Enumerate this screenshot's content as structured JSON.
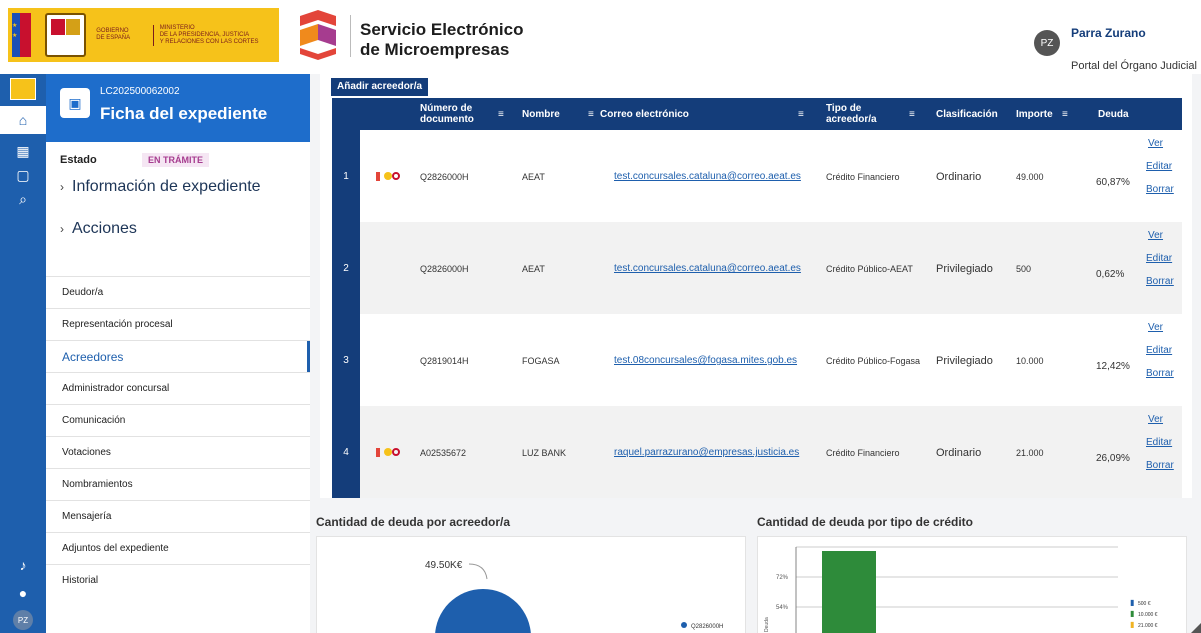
{
  "header": {
    "gob_line1": "GOBIERNO",
    "gob_line2": "DE ESPAÑA",
    "ministry_line1": "MINISTERIO",
    "ministry_line2": "DE LA PRESIDENCIA, JUSTICIA",
    "ministry_line3": "Y RELACIONES CON LAS CORTES",
    "service_line1": "Servicio Electrónico",
    "service_line2": "de Microempresas",
    "user_initials": "PZ",
    "user_name": "Parra Zurano",
    "portal": "Portal del Órgano Judicial"
  },
  "rail": {
    "bottom_initials": "PZ"
  },
  "side": {
    "case_code": "LC202500062002",
    "title": "Ficha del expediente",
    "estado_label": "Estado",
    "estado_value": "EN TRÁMITE",
    "accordion": [
      "Información de expediente",
      "Acciones"
    ],
    "menu": [
      "Deudor/a",
      "Representación procesal",
      "Acreedores",
      "Administrador concursal",
      "Comunicación",
      "Votaciones",
      "Nombramientos",
      "Mensajería",
      "Adjuntos del expediente",
      "Historial"
    ],
    "active": "Acreedores"
  },
  "table": {
    "add_button": "Añadir acreedor/a",
    "headers": {
      "doc": "Número de documento",
      "nombre": "Nombre",
      "correo": "Correo electrónico",
      "tipo": "Tipo de acreedor/a",
      "clasificacion": "Clasificación",
      "importe": "Importe",
      "deuda": "Deuda"
    },
    "rows": [
      {
        "n": "1",
        "doc": "Q2826000H",
        "nombre": "AEAT",
        "correo": "test.concursales.cataluna@correo.aeat.es",
        "tipo": "Crédito Financiero",
        "clasificacion": "Ordinario",
        "importe": "49.000",
        "deuda": "60,87%"
      },
      {
        "n": "2",
        "doc": "Q2826000H",
        "nombre": "AEAT",
        "correo": "test.concursales.cataluna@correo.aeat.es",
        "tipo": "Crédito Público-AEAT",
        "clasificacion": "Privilegiado",
        "importe": "500",
        "deuda": "0,62%"
      },
      {
        "n": "3",
        "doc": "Q2819014H",
        "nombre": "FOGASA",
        "correo": "test.08concursales@fogasa.mites.gob.es",
        "tipo": "Crédito Público-Fogasa",
        "clasificacion": "Privilegiado",
        "importe": "10.000",
        "deuda": "12,42%"
      },
      {
        "n": "4",
        "doc": "A02535672",
        "nombre": "LUZ BANK",
        "correo": "raquel.parrazurano@empresas.justicia.es",
        "tipo": "Crédito Financiero",
        "clasificacion": "Ordinario",
        "importe": "21.000",
        "deuda": "26,09%"
      }
    ],
    "actions": {
      "ver": "Ver",
      "editar": "Editar",
      "borrar": "Borrar"
    }
  },
  "charts": {
    "left_title": "Cantidad de deuda por acreedor/a",
    "right_title": "Cantidad de deuda por tipo de crédito"
  },
  "chart_data": [
    {
      "type": "pie",
      "title": "Cantidad de deuda por acreedor/a",
      "slice_label": "49.50K€",
      "legend": [
        "Q2826000H"
      ],
      "colors": [
        "#1e5fad"
      ]
    },
    {
      "type": "bar",
      "title": "Cantidad de deuda por tipo de crédito",
      "ylabel": "Deuda",
      "y_ticks": [
        "72%",
        "54%"
      ],
      "bar_color": "#2e8b3a",
      "legend": [
        "500 €",
        "10.000 €",
        "21.000 €"
      ]
    }
  ]
}
